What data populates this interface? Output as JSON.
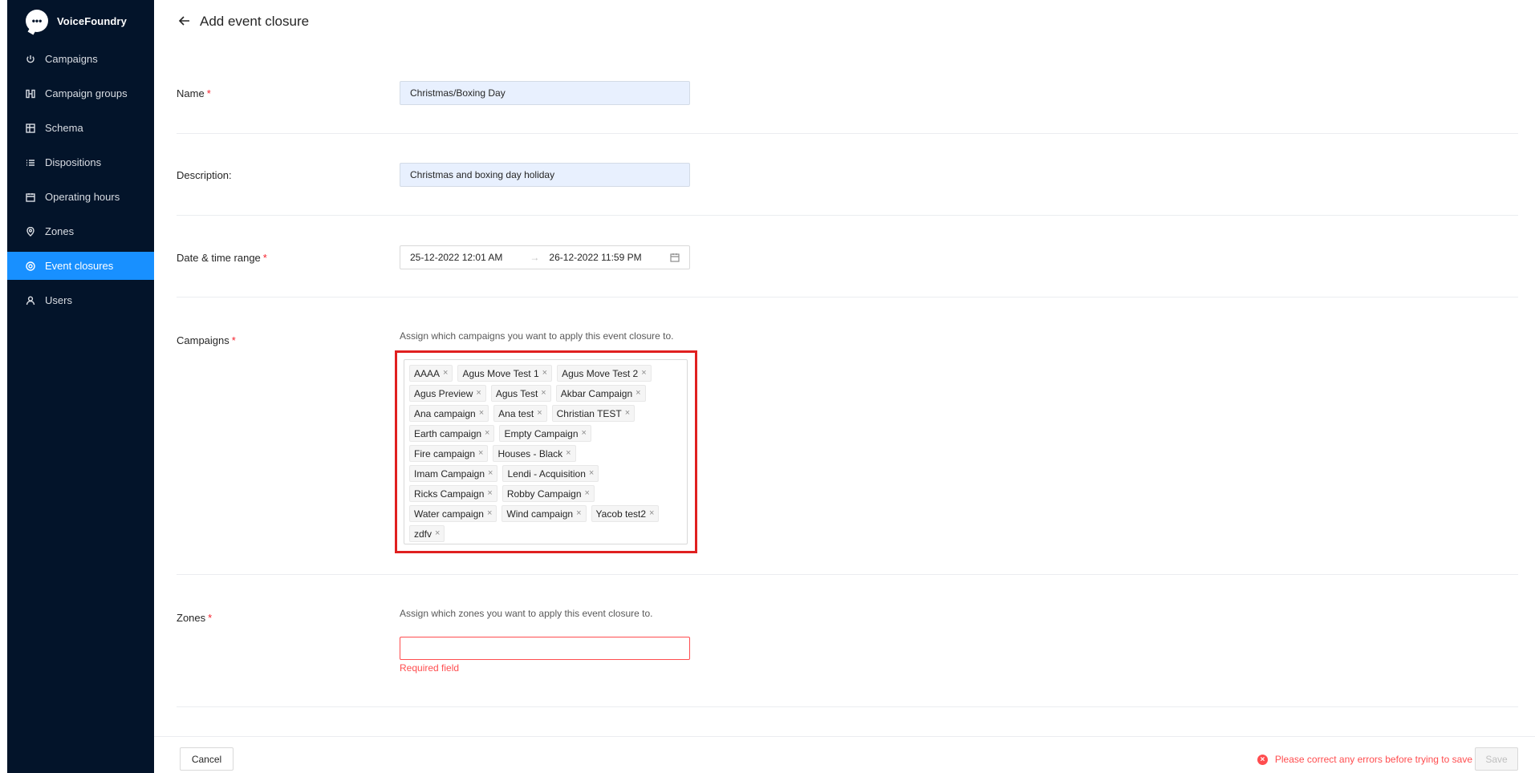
{
  "app": {
    "brand": "VoiceFoundry"
  },
  "sidebar": {
    "items": [
      {
        "label": "Campaigns",
        "icon": "power-icon"
      },
      {
        "label": "Campaign groups",
        "icon": "campaign-groups-icon"
      },
      {
        "label": "Schema",
        "icon": "schema-icon"
      },
      {
        "label": "Dispositions",
        "icon": "list-icon"
      },
      {
        "label": "Operating hours",
        "icon": "calendar-icon"
      },
      {
        "label": "Zones",
        "icon": "location-icon"
      },
      {
        "label": "Event closures",
        "icon": "event-closure-icon",
        "active": true
      },
      {
        "label": "Users",
        "icon": "user-icon"
      }
    ]
  },
  "header": {
    "title": "Add event closure"
  },
  "form": {
    "name": {
      "label": "Name",
      "required_mark": "*",
      "value": "Christmas/Boxing Day"
    },
    "description": {
      "label": "Description:",
      "value": "Christmas and boxing day holiday"
    },
    "date_range": {
      "label": "Date & time range",
      "required_mark": "*",
      "start": "25-12-2022 12:01 AM",
      "separator": "→",
      "end": "26-12-2022 11:59 PM"
    },
    "campaigns": {
      "label": "Campaigns",
      "required_mark": "*",
      "hint": "Assign which campaigns you want to apply this event closure to.",
      "tags": [
        "AAAA",
        "Agus Move Test 1",
        "Agus Move Test 2",
        "Agus Preview",
        "Agus Test",
        "Akbar Campaign",
        "Ana campaign",
        "Ana test",
        "Christian TEST",
        "Earth campaign",
        "Empty Campaign",
        "Fire campaign",
        "Houses - Black",
        "Imam Campaign",
        "Lendi - Acquisition",
        "Ricks Campaign",
        "Robby Campaign",
        "Water campaign",
        "Wind campaign",
        "Yacob test2",
        "zdfv"
      ]
    },
    "zones": {
      "label": "Zones",
      "required_mark": "*",
      "hint": "Assign which zones you want to apply this event closure to.",
      "error": "Required field"
    }
  },
  "footer": {
    "cancel_label": "Cancel",
    "error_message": "Please correct any errors before trying to save",
    "save_label": "Save"
  },
  "colors": {
    "sidebar_bg": "#03142a",
    "active": "#1890ff",
    "error": "#ff4d4f",
    "highlight": "#e02020"
  }
}
